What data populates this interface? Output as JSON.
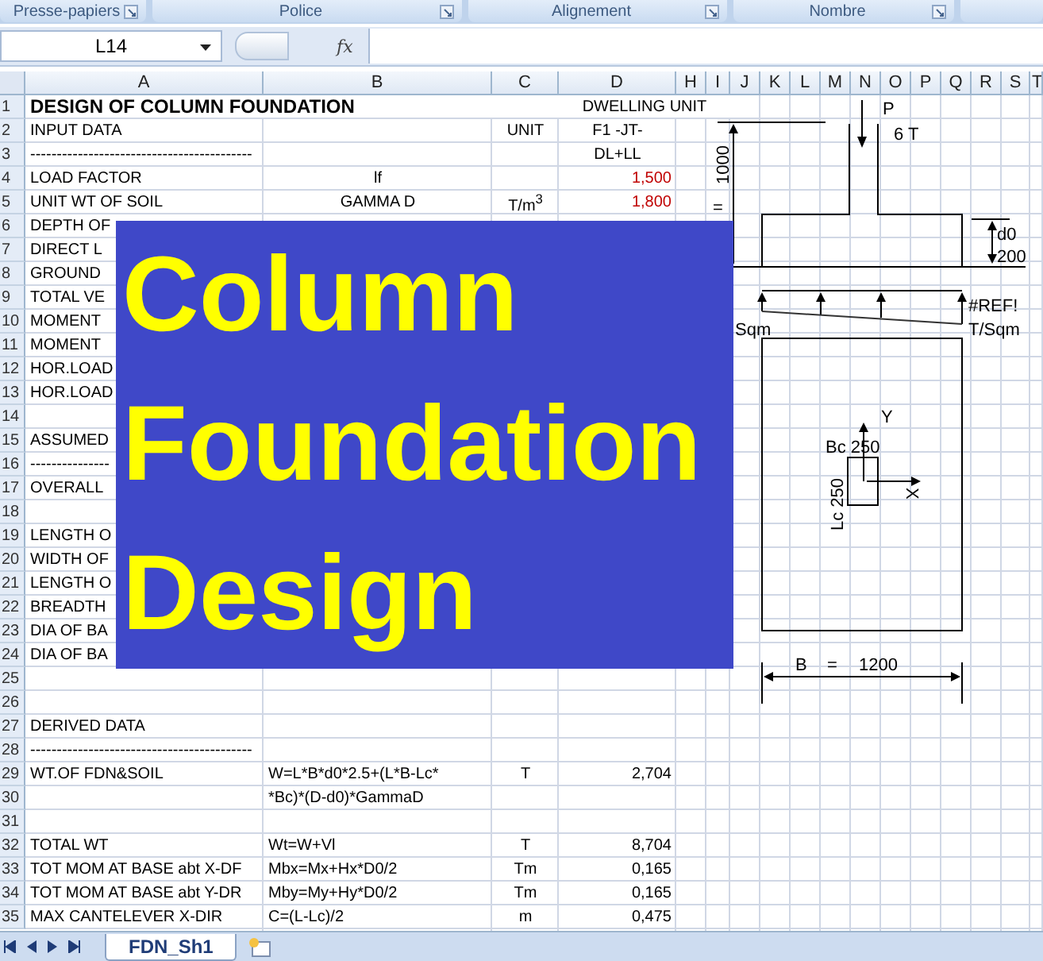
{
  "ribbon_groups": [
    {
      "label": "Presse-papiers"
    },
    {
      "label": "Police"
    },
    {
      "label": "Alignement"
    },
    {
      "label": "Nombre"
    }
  ],
  "formula_bar": {
    "name_box": "L14",
    "function_label": "fx"
  },
  "columns": [
    "A",
    "B",
    "C",
    "D",
    "H",
    "I",
    "J",
    "K",
    "L",
    "M",
    "N",
    "O",
    "P",
    "Q",
    "R",
    "S",
    "T"
  ],
  "sheet_title": {
    "n": "1",
    "title": "DESIGN OF COLUMN FOUNDATION",
    "project": "DWELLING UNIT"
  },
  "rows": [
    {
      "n": "2",
      "kind": "header",
      "a": "INPUT DATA",
      "c": "UNIT",
      "d": "F1 -JT-",
      "input_value": false
    },
    {
      "n": "3",
      "kind": "header",
      "a": "------------------------------------------",
      "d": "DL+LL",
      "input_value": false
    },
    {
      "n": "4",
      "kind": "input",
      "a": "LOAD FACTOR",
      "b": "lf",
      "d": "1,500",
      "input_value": true
    },
    {
      "n": "5",
      "kind": "input",
      "a": "UNIT WT OF SOIL",
      "b": "GAMMA D",
      "c": "T/m$^{3}$",
      "d": "1,800",
      "input_value": true
    },
    {
      "n": "6",
      "kind": "input",
      "a": "DEPTH OF"
    },
    {
      "n": "7",
      "kind": "input",
      "a": "DIRECT L"
    },
    {
      "n": "8",
      "kind": "input",
      "a": "GROUND"
    },
    {
      "n": "9",
      "kind": "input",
      "a": "TOTAL VE"
    },
    {
      "n": "10",
      "kind": "input",
      "a": "MOMENT"
    },
    {
      "n": "11",
      "kind": "input",
      "a": "MOMENT"
    },
    {
      "n": "12",
      "kind": "input",
      "a": "HOR.LOAD"
    },
    {
      "n": "13",
      "kind": "input",
      "a": "HOR.LOAD"
    },
    {
      "n": "14",
      "kind": "input"
    },
    {
      "n": "15",
      "kind": "input",
      "a": "ASSUMED"
    },
    {
      "n": "16",
      "kind": "input",
      "a": "---------------"
    },
    {
      "n": "17",
      "kind": "input",
      "a": "OVERALL"
    },
    {
      "n": "18",
      "kind": "input"
    },
    {
      "n": "19",
      "kind": "input",
      "a": "LENGTH O"
    },
    {
      "n": "20",
      "kind": "input",
      "a": "WIDTH OF"
    },
    {
      "n": "21",
      "kind": "input",
      "a": "LENGTH O"
    },
    {
      "n": "22",
      "kind": "input",
      "a": "BREADTH"
    },
    {
      "n": "23",
      "kind": "input",
      "a": "DIA OF BA"
    },
    {
      "n": "24",
      "kind": "input",
      "a": "DIA OF BA"
    },
    {
      "n": "25",
      "kind": "derived"
    },
    {
      "n": "26",
      "kind": "derived"
    },
    {
      "n": "27",
      "kind": "derived",
      "a": "DERIVED DATA"
    },
    {
      "n": "28",
      "kind": "derived",
      "a": "------------------------------------------"
    },
    {
      "n": "29",
      "kind": "derived",
      "a": "WT.OF FDN&SOIL",
      "b": "W=L*B*d0*2.5+(L*B-Lc*",
      "c": "T",
      "d": "2,704",
      "input_value": false
    },
    {
      "n": "30",
      "kind": "derived",
      "b": "*Bc)*(D-d0)*GammaD"
    },
    {
      "n": "31",
      "kind": "derived"
    },
    {
      "n": "32",
      "kind": "derived",
      "a": "TOTAL WT",
      "b": "Wt=W+Vl",
      "c": "T",
      "d": "8,704",
      "input_value": false
    },
    {
      "n": "33",
      "kind": "derived",
      "a": "TOT MOM AT BASE abt X-DF",
      "b": "Mbx=Mx+Hx*D0/2",
      "c": "Tm",
      "d": "0,165",
      "input_value": false
    },
    {
      "n": "34",
      "kind": "derived",
      "a": "TOT MOM AT BASE abt Y-DR",
      "b": "Mby=My+Hy*D0/2",
      "c": "Tm",
      "d": "0,165",
      "input_value": false
    },
    {
      "n": "35",
      "kind": "derived",
      "a": "MAX CANTELEVER X-DIR",
      "b": "C=(L-Lc)/2",
      "c": "m",
      "d": "0,475",
      "input_value": false
    }
  ],
  "banner": {
    "title": "Column Foundation Design"
  },
  "diagram": {
    "load_label": "P",
    "load_value": "6 T",
    "height_value": "1000",
    "height_eq": "=",
    "depth_label": "d0",
    "depth_value": "200",
    "pressure_max": "#REF!",
    "pressure_unit": "T/Sqm",
    "pressure_unit_left": "Sqm",
    "axis_y": "Y",
    "axis_x": "X",
    "column_width": "Bc 250",
    "column_length": "Lc 250",
    "width_label": "B",
    "width_eq": "=",
    "width_value": "1200"
  },
  "sheet_tabs": [
    {
      "label": "FDN_Sh1",
      "selected": true
    }
  ]
}
